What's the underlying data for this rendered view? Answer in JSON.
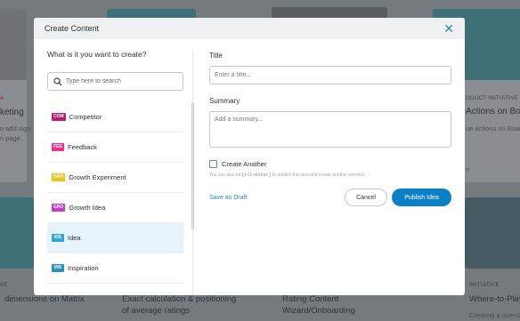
{
  "background": {
    "left_tag": "A",
    "left_title": "keting",
    "left_desc_1": "o add sign-",
    "left_desc_2": "n page.",
    "right_tag": "ODUCT INITIATIVE",
    "right_title": "Actions on Boar",
    "right_desc_1": "ue actions on Board",
    "right_desc_2": "n",
    "bottom_tag_left": "VE",
    "bottom_tag_right": "INITIATIVE",
    "bottom_title_1": "dimensions on Matrix",
    "bottom_title_2a": "Exact calculation & positioning",
    "bottom_title_2b": "of average ratings",
    "bottom_title_3a": "Rating Content",
    "bottom_title_3b": "Wizard/Onboarding",
    "bottom_title_4": "Where-to-Play Onbo",
    "bottom_desc_4": "Creating a user-centric O"
  },
  "modal": {
    "title": "Create Content",
    "close_glyph": "✕"
  },
  "left_panel": {
    "heading": "What is it you want to create?",
    "search_placeholder": "Type here to search",
    "items": [
      {
        "tag": "COM",
        "label": "Competitor",
        "color": "#b51f6f"
      },
      {
        "tag": "FEE",
        "label": "Feedback",
        "color": "#e8318a"
      },
      {
        "tag": "GRO",
        "label": "Growth Experiment",
        "color": "#e6c419"
      },
      {
        "tag": "GRO",
        "label": "Growth Idea",
        "color": "#c03ec2"
      },
      {
        "tag": "IDE",
        "label": "Idea",
        "color": "#2fa4d8"
      },
      {
        "tag": "INS",
        "label": "Inspiration",
        "color": "#2b8fc6"
      }
    ]
  },
  "form": {
    "title_label": "Title",
    "title_placeholder": "Enter a title...",
    "summary_label": "Summary",
    "summary_placeholder": "Add a summary...",
    "create_another_label": "Create Another",
    "hint_prefix": "You can also hit",
    "hint_keys": "[Alt+Enter]",
    "hint_suffix": "to publish the Idea and create another element.",
    "save_draft_label": "Save as Draft",
    "cancel_label": "Cancel",
    "publish_label": "Publish Idea"
  }
}
